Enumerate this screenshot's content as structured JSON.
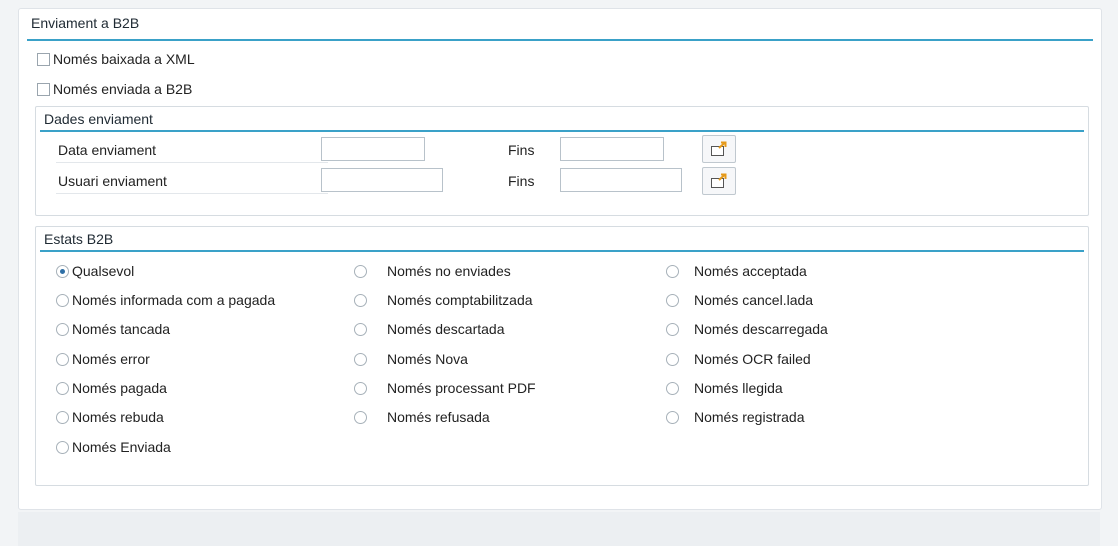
{
  "section": {
    "title": "Enviament a B2B"
  },
  "checkboxes": [
    {
      "label": "Només baixada a XML",
      "checked": false
    },
    {
      "label": "Només enviada a B2B",
      "checked": false
    }
  ],
  "dades": {
    "title": "Dades enviament",
    "rows": [
      {
        "label": "Data enviament",
        "fins": "Fins",
        "from_value": "",
        "to_value": ""
      },
      {
        "label": "Usuari enviament",
        "fins": "Fins",
        "from_value": "",
        "to_value": ""
      }
    ]
  },
  "estats": {
    "title": "Estats B2B",
    "col1": [
      "Qualsevol",
      "Només informada com a pagada",
      "Només tancada",
      "Només error",
      "Només pagada",
      "Només rebuda",
      "Només Enviada"
    ],
    "col2": [
      "Només no enviades",
      "Només comptabilitzada",
      "Només descartada",
      "Només Nova",
      "Només processant PDF",
      "Només refusada"
    ],
    "col3": [
      "Només acceptada",
      "Només cancel.lada",
      "Només descarregada",
      "Només OCR failed",
      "Només llegida",
      "Només registrada"
    ],
    "selected": "Qualsevol"
  },
  "colors": {
    "accent_line": "#3aa1c8",
    "radio_dot": "#2f6fa6"
  },
  "icons": {
    "multiple_selection": "multiple-selection-icon"
  }
}
